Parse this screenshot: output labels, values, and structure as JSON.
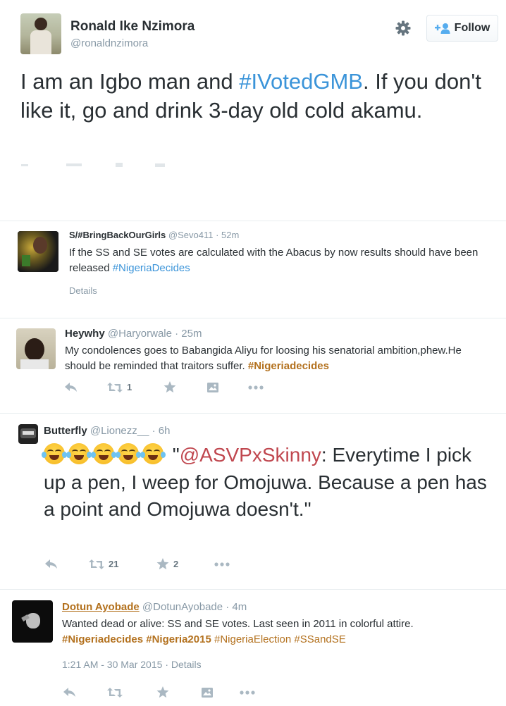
{
  "main_tweet": {
    "name": "Ronald Ike Nzimora",
    "handle": "@ronaldnzimora",
    "follow_label": "Follow",
    "text_before": "I am an Igbo man and ",
    "hashtag": "#IVotedGMB",
    "text_after": ". If you don't like it, go and drink 3-day old cold akamu."
  },
  "replies": [
    {
      "name": "S/#BringBackOurGirls",
      "handle": "@Sevo411",
      "time": "· 52m",
      "text_before": "If the SS and SE votes are calculated with the Abacus by now results should have been released ",
      "hashtag": "#NigeriaDecides",
      "details": "Details"
    },
    {
      "name": "Heywhy",
      "handle": "@Haryorwale",
      "time": "· 25m",
      "text_before": "My condolences goes to Babangida Aliyu for loosing his senatorial ambition,phew.He should be reminded that traitors suffer. ",
      "hashtag": "#Nigeriadecides",
      "retweet_count": "1"
    },
    {
      "name": "Butterfly",
      "handle": "@Lionezz__",
      "time": "· 6h",
      "emoji_count": 5,
      "text_quote_open": " \"",
      "mention": "@ASVPxSkinny",
      "text_after": ": Everytime I pick up a pen, I weep for Omojuwa. Because a pen has a point and Omojuwa doesn't.\"",
      "retweet_count": "21",
      "favorite_count": "2"
    },
    {
      "name": "Dotun Ayobade",
      "handle": "@DotunAyobade",
      "time": "· 4m",
      "text_line1": "Wanted dead or alive: SS and SE votes. Last seen in 2011 in colorful attire.",
      "hashtag1": "#Nigeriadecides",
      "hashtag2": "#Nigeria2015",
      "hashtag3": "#NigeriaElection",
      "hashtag4": "#SSandSE",
      "timestamp": "1:21 AM - 30 Mar 2015",
      "details": "· Details"
    }
  ],
  "colors": {
    "hashtag_blue": "#3b94d9",
    "hashtag_orange": "#b3711e",
    "mention_red": "#c0474f",
    "icon_grey": "#aab8c2"
  }
}
